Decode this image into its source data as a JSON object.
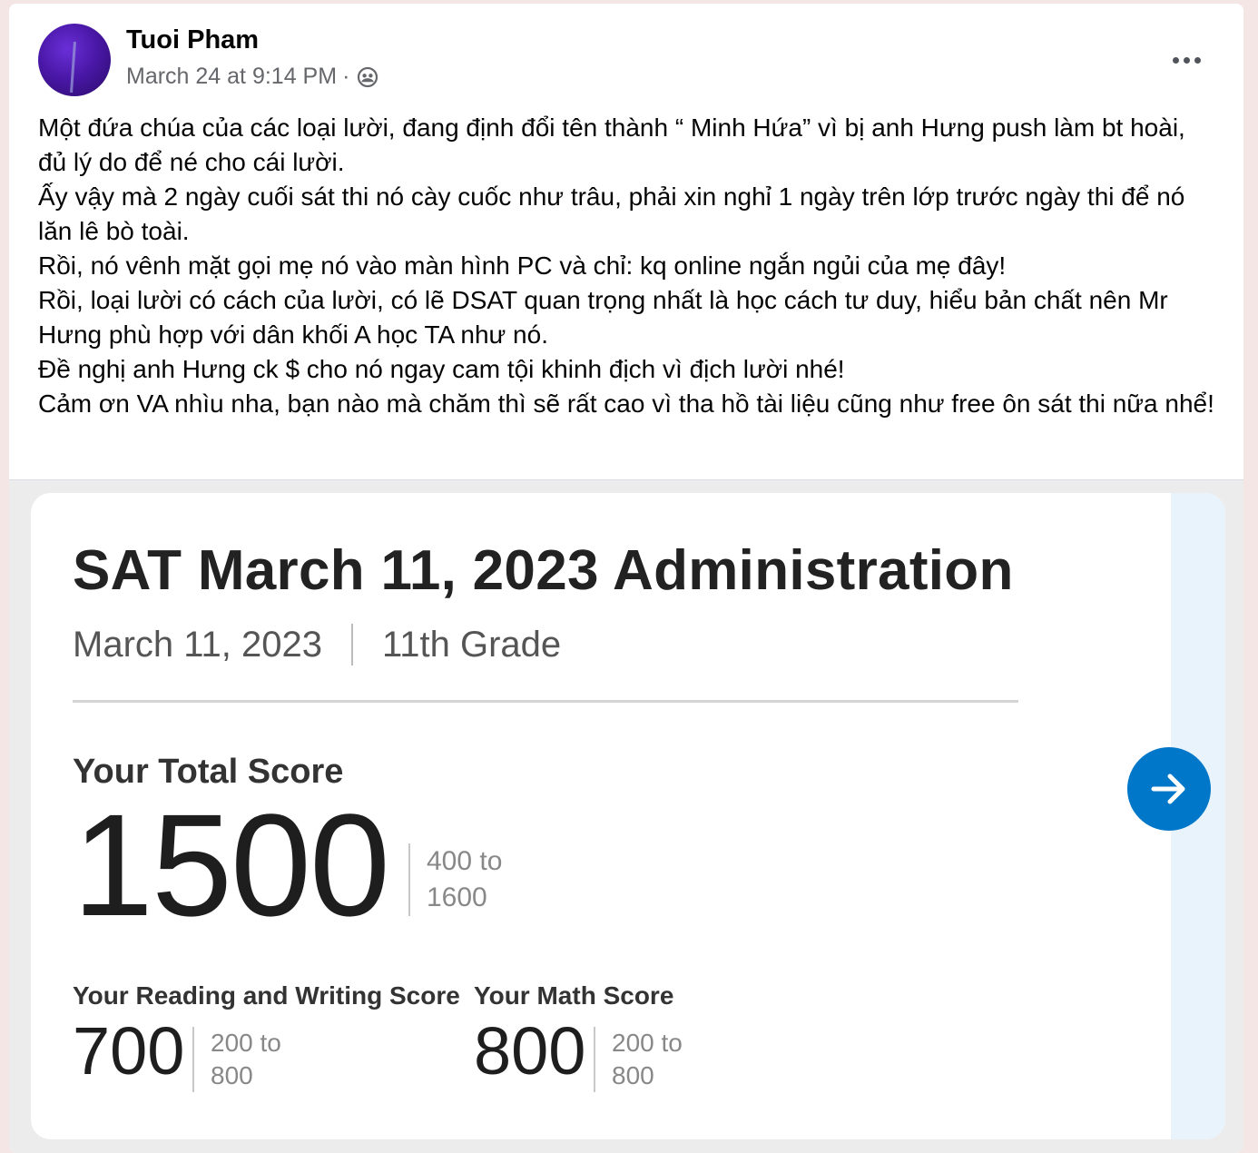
{
  "post": {
    "author": "Tuoi Pham",
    "timestamp": "March 24 at 9:14 PM",
    "separator": "·",
    "audience_icon": "friends-icon",
    "more_icon": "more-options-icon",
    "paragraphs": [
      "Một đứa chúa của các loại lười, đang định đổi tên thành “ Minh Hứa” vì bị anh Hưng push làm bt hoài, đủ lý do để né cho cái lười.",
      "Ấy vậy mà 2 ngày cuối sát thi nó cày cuốc như trâu, phải xin nghỉ 1 ngày trên lớp trước ngày thi để nó lăn lê bò toài.",
      "Rồi, nó vênh mặt gọi mẹ nó vào màn hình PC và chỉ: kq online ngắn ngủi của mẹ đây!",
      "Rồi, loại lười có cách của lười, có lẽ DSAT quan trọng nhất là học cách tư duy, hiểu bản chất nên Mr Hưng phù hợp với dân khối A học TA như nó.",
      "Đề nghị anh Hưng ck $ cho nó ngay cam tội khinh địch vì địch lười nhé!",
      "Cảm ơn VA nhìu nha, bạn nào mà chăm thì sẽ rất cao vì tha hồ tài liệu cũng như free ôn sát thi nữa nhể!"
    ]
  },
  "score_report": {
    "title": "SAT March 11, 2023 Administration",
    "date": "March 11, 2023",
    "grade": "11th Grade",
    "total": {
      "label": "Your Total Score",
      "score": "1500",
      "range_top": "400 to",
      "range_bottom": "1600"
    },
    "reading_writing": {
      "label": "Your Reading and Writing Score",
      "score": "700",
      "range_top": "200 to",
      "range_bottom": "800"
    },
    "math": {
      "label": "Your Math Score",
      "score": "800",
      "range_top": "200 to",
      "range_bottom": "800"
    },
    "next_icon": "arrow-right-icon",
    "accent_color": "#0077c8"
  }
}
